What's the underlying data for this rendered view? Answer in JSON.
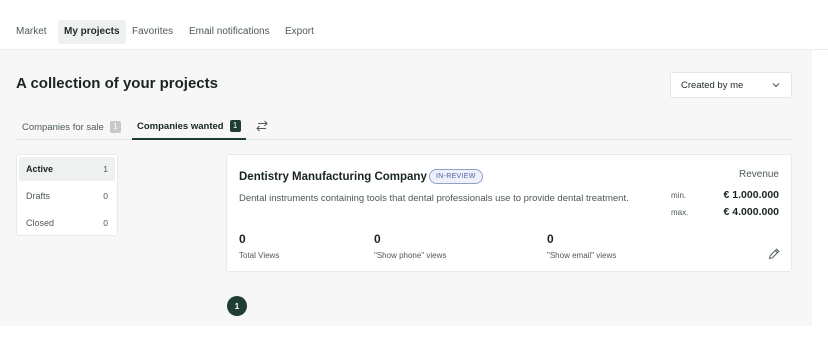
{
  "nav": {
    "items": [
      {
        "label": "Market"
      },
      {
        "label": "My projects",
        "active": true
      },
      {
        "label": "Favorites"
      },
      {
        "label": "Email notifications"
      },
      {
        "label": "Export"
      }
    ]
  },
  "header": {
    "title": "A collection of your projects",
    "filter_value": "Created by me",
    "filter_icon": "chevron-down-icon"
  },
  "tabs": [
    {
      "label": "Companies for sale",
      "count": "1"
    },
    {
      "label": "Companies wanted",
      "count": "1",
      "active": true
    }
  ],
  "swap_icon": "swap-arrows-icon",
  "status_filters": [
    {
      "label": "Active",
      "count": "1",
      "active": true
    },
    {
      "label": "Drafts",
      "count": "0"
    },
    {
      "label": "Closed",
      "count": "0"
    }
  ],
  "project": {
    "company": "Dentistry Manufacturing Company",
    "badge": "IN-REVIEW",
    "description": "Dental instruments containing tools that dental professionals use to provide dental treatment.",
    "revenue_title": "Revenue",
    "revenue_min_label": "min.",
    "revenue_min": "€ 1.000.000",
    "revenue_max_label": "max.",
    "revenue_max": "€ 4.000.000",
    "stats": [
      {
        "value": "0",
        "label": "Total Views"
      },
      {
        "value": "0",
        "label": "\"Show phone\" views"
      },
      {
        "value": "0",
        "label": "\"Show email\" views"
      }
    ],
    "edit_icon": "pencil-icon"
  },
  "pagination": {
    "current": "1"
  },
  "colors": {
    "accent": "#1e3d33",
    "badge_border": "#8fa1c8",
    "badge_text": "#4f62a0",
    "page_bg": "#f6f7f6"
  }
}
